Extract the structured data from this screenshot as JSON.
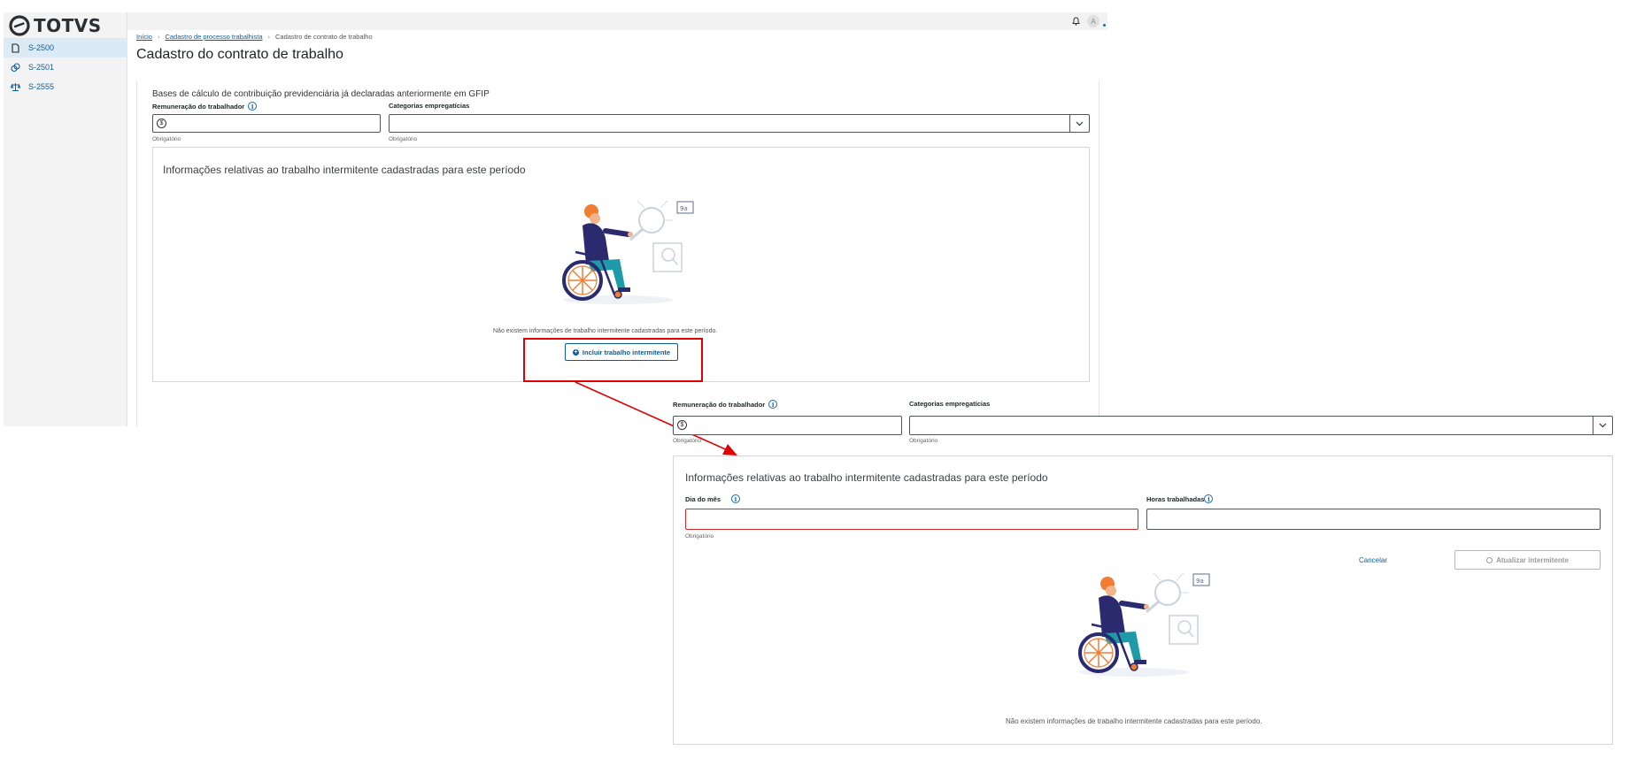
{
  "app": {
    "logo_text": "TOTVS",
    "sidebar": {
      "items": [
        {
          "label": "S-2500",
          "icon": "file-icon",
          "active": true
        },
        {
          "label": "S-2501",
          "icon": "coins-icon",
          "active": false
        },
        {
          "label": "S-2555",
          "icon": "scale-icon",
          "active": false
        }
      ]
    },
    "topbar": {
      "avatar_initial": "A"
    }
  },
  "breadcrumb": {
    "home": "Início",
    "parent": "Cadastro de processo trabalhista",
    "current": "Cadastro de contrato de trabalho"
  },
  "page_title": "Cadastro do contrato de trabalho",
  "form": {
    "bases_text": "Bases de cálculo de contribuição previdenciária já declaradas anteriormente em GFIP",
    "remuneracao_label": "Remuneração do trabalhador",
    "categorias_label": "Categorias empregatícias",
    "required_hint": "Obrigatório",
    "currency_symbol": "$"
  },
  "intermitente_card": {
    "title": "Informações relativas ao trabalho intermitente cadastradas para este período",
    "empty_text": "Não existem informações de trabalho intermitente cadastradas para este período.",
    "add_button": "Incluir trabalho intermitente"
  },
  "expanded_form": {
    "remuneracao_label": "Remuneração do trabalhador",
    "categorias_label": "Categorias empregatícias",
    "required_hint": "Obrigatório",
    "card_title": "Informações relativas ao trabalho intermitente cadastradas para este período",
    "dia_label": "Dia do mês",
    "horas_label": "Horas trabalhadas",
    "dia_hint": "Obrigatório",
    "cancel_label": "Cancelar",
    "update_label": "Atualizar intermitente",
    "empty_text": "Não existem informações de trabalho intermitente cadastradas para este período."
  },
  "colors": {
    "brand_blue": "#0c5b9a",
    "annotation_red": "#e00000",
    "error_red": "#d62828",
    "sidebar_active": "#dceaf6"
  }
}
